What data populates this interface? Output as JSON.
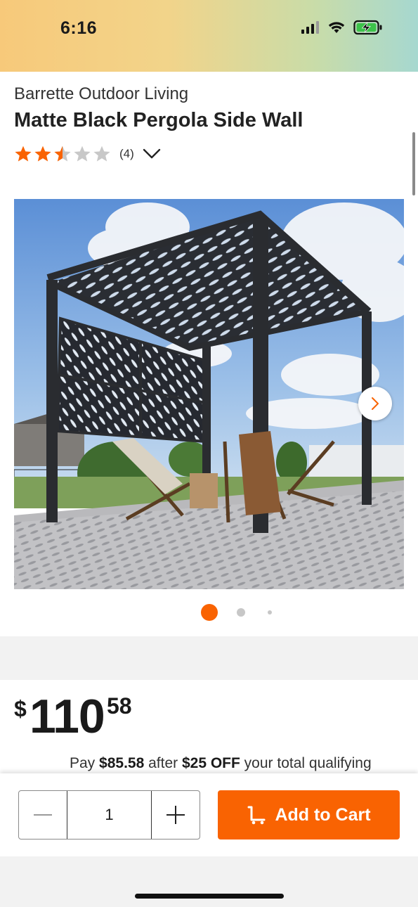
{
  "status_bar": {
    "time": "6:16",
    "icons": [
      "cellular-signal-icon",
      "wifi-icon",
      "battery-charging-icon"
    ]
  },
  "product": {
    "brand": "Barrette Outdoor Living",
    "title": "Matte Black Pergola Side Wall",
    "rating": 2.5,
    "rating_max": 5,
    "review_count": "(4)"
  },
  "gallery": {
    "image_alt_icon": "pergola-product-photo",
    "active_index": 0,
    "dot_count": 3
  },
  "price": {
    "currency": "$",
    "whole": "110",
    "cents": "58"
  },
  "promo": {
    "prefix": "Pay ",
    "amount": "$85.58",
    "middle": " after ",
    "discount": "$25 OFF",
    "suffix": " your total qualifying"
  },
  "cart": {
    "quantity": "1",
    "add_label": "Add to Cart"
  },
  "colors": {
    "accent": "#f96302"
  }
}
